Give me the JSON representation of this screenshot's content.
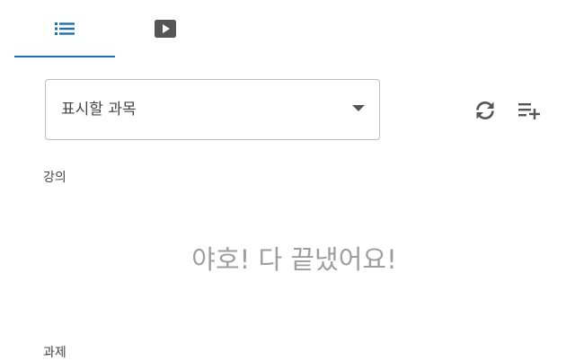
{
  "tabs": [
    {
      "icon": "list-icon",
      "active": true
    },
    {
      "icon": "play-icon",
      "active": false
    }
  ],
  "course_select": {
    "selected_label": "표시할 과목",
    "icon": "dropdown-caret-icon"
  },
  "toolbar": {
    "refresh_icon": "refresh-icon",
    "add_list_icon": "playlist-add-icon"
  },
  "sections": {
    "lectures_label": "강의",
    "lectures_empty_message": "야호! 다 끝냈어요!",
    "assignments_label": "과제"
  },
  "colors": {
    "accent": "#1c6fb5",
    "muted_text": "#9e9e9e",
    "icon": "#555555"
  }
}
